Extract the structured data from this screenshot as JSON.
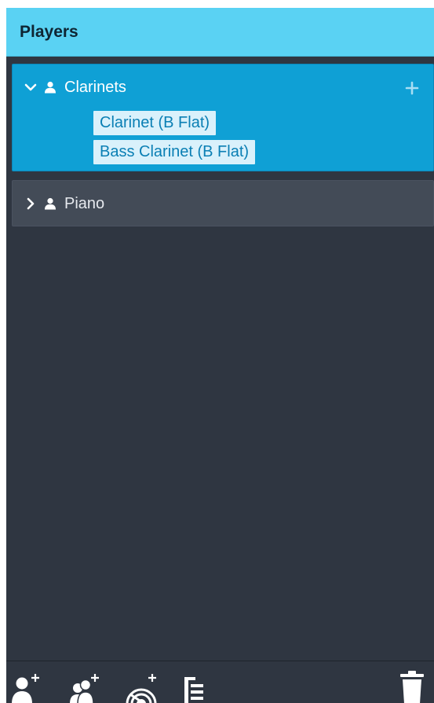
{
  "panel": {
    "title": "Players"
  },
  "players": [
    {
      "name": "Clarinets",
      "expanded": true,
      "selected": true,
      "instruments": [
        "Clarinet (B Flat)",
        "Bass Clarinet (B Flat)"
      ]
    },
    {
      "name": "Piano",
      "expanded": false,
      "selected": false,
      "instruments": []
    }
  ],
  "toolbar": {
    "buttons": [
      "add-solo-player-icon",
      "add-section-player-icon",
      "add-percussion-kit-icon",
      "add-group-icon",
      "delete-icon"
    ]
  },
  "colors": {
    "header": "#5ad2f3",
    "panel_bg": "#2f3641",
    "selected_card": "#0fa0d5",
    "card": "#434b57",
    "chip_bg": "#d9f1fb",
    "chip_text": "#0a7fb4"
  }
}
